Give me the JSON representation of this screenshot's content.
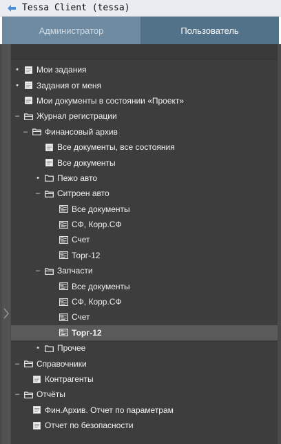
{
  "window": {
    "title": "Tessa Client (tessa)"
  },
  "tabs": [
    {
      "label": "Администратор",
      "active": false
    },
    {
      "label": "Пользователь",
      "active": true
    }
  ],
  "tree": [
    {
      "label": "Мои задания",
      "level": 0,
      "icon": "document-icon",
      "expander": "•"
    },
    {
      "label": "Задания от меня",
      "level": 0,
      "icon": "document-icon",
      "expander": "•"
    },
    {
      "label": "Мои документы в состоянии «Проект»",
      "level": 0,
      "icon": "document-icon",
      "expander": ""
    },
    {
      "label": "Журнал регистрации",
      "level": 0,
      "icon": "folder-open-icon",
      "expander": "–"
    },
    {
      "label": "Финансовый архив",
      "level": 1,
      "icon": "folder-open-icon",
      "expander": "–"
    },
    {
      "label": "Все документы, все состояния",
      "level": 2,
      "icon": "document-icon",
      "expander": ""
    },
    {
      "label": "Все документы",
      "level": 2,
      "icon": "document-icon",
      "expander": ""
    },
    {
      "label": "Пежо авто",
      "level": 2,
      "icon": "folder-icon",
      "expander": "•"
    },
    {
      "label": "Ситроен авто",
      "level": 2,
      "icon": "folder-open-icon",
      "expander": "–"
    },
    {
      "label": "Все документы",
      "level": 3,
      "icon": "view-icon",
      "expander": ""
    },
    {
      "label": "СФ, Корр.СФ",
      "level": 3,
      "icon": "view-icon",
      "expander": ""
    },
    {
      "label": "Счет",
      "level": 3,
      "icon": "view-icon",
      "expander": ""
    },
    {
      "label": "Торг-12",
      "level": 3,
      "icon": "view-icon",
      "expander": ""
    },
    {
      "label": "Запчасти",
      "level": 2,
      "icon": "folder-open-icon",
      "expander": "–"
    },
    {
      "label": "Все документы",
      "level": 3,
      "icon": "view-icon",
      "expander": ""
    },
    {
      "label": "СФ, Корр.СФ",
      "level": 3,
      "icon": "view-icon",
      "expander": ""
    },
    {
      "label": "Счет",
      "level": 3,
      "icon": "view-icon",
      "expander": ""
    },
    {
      "label": "Торг-12",
      "level": 3,
      "icon": "view-icon",
      "expander": "",
      "selected": true
    },
    {
      "label": "Прочее",
      "level": 2,
      "icon": "folder-icon",
      "expander": "•"
    },
    {
      "label": "Справочники",
      "level": 0,
      "icon": "folder-open-icon",
      "expander": "–"
    },
    {
      "label": "Контрагенты",
      "level": 1,
      "icon": "document-icon",
      "expander": ""
    },
    {
      "label": "Отчёты",
      "level": 0,
      "icon": "folder-open-icon",
      "expander": "–"
    },
    {
      "label": "Фин.Архив. Отчет по параметрам",
      "level": 1,
      "icon": "document-icon",
      "expander": ""
    },
    {
      "label": "Отчет по безопасности",
      "level": 1,
      "icon": "document-icon",
      "expander": ""
    }
  ],
  "colors": {
    "tab_admin_bg": "#6d8aa0",
    "tab_user_bg": "#517288",
    "tree_bg": "#3d3d3d",
    "selected_row_bg": "#5a5a5a",
    "tree_text": "#f2f2f2"
  }
}
